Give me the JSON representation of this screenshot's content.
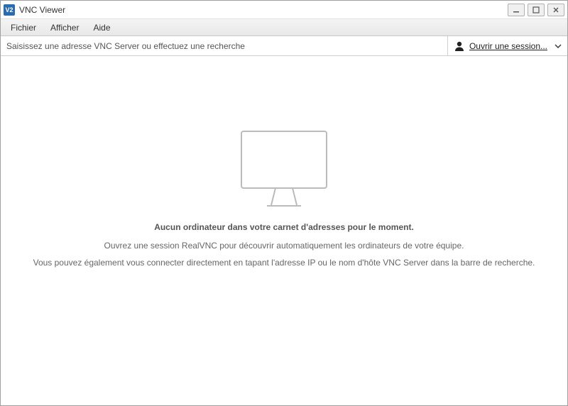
{
  "app": {
    "icon_text": "V2",
    "title": "VNC Viewer"
  },
  "menu": {
    "file": "Fichier",
    "view": "Afficher",
    "help": "Aide"
  },
  "toolbar": {
    "search_placeholder": "Saisissez une adresse VNC Server ou effectuez une recherche",
    "session_label": "Ouvrir une session..."
  },
  "empty": {
    "title": "Aucun ordinateur dans votre carnet d'adresses pour le moment.",
    "line1": "Ouvrez une session RealVNC pour découvrir automatiquement les ordinateurs de votre équipe.",
    "line2": "Vous pouvez également vous connecter directement en tapant l'adresse IP ou le nom d'hôte VNC Server dans la barre de recherche."
  }
}
